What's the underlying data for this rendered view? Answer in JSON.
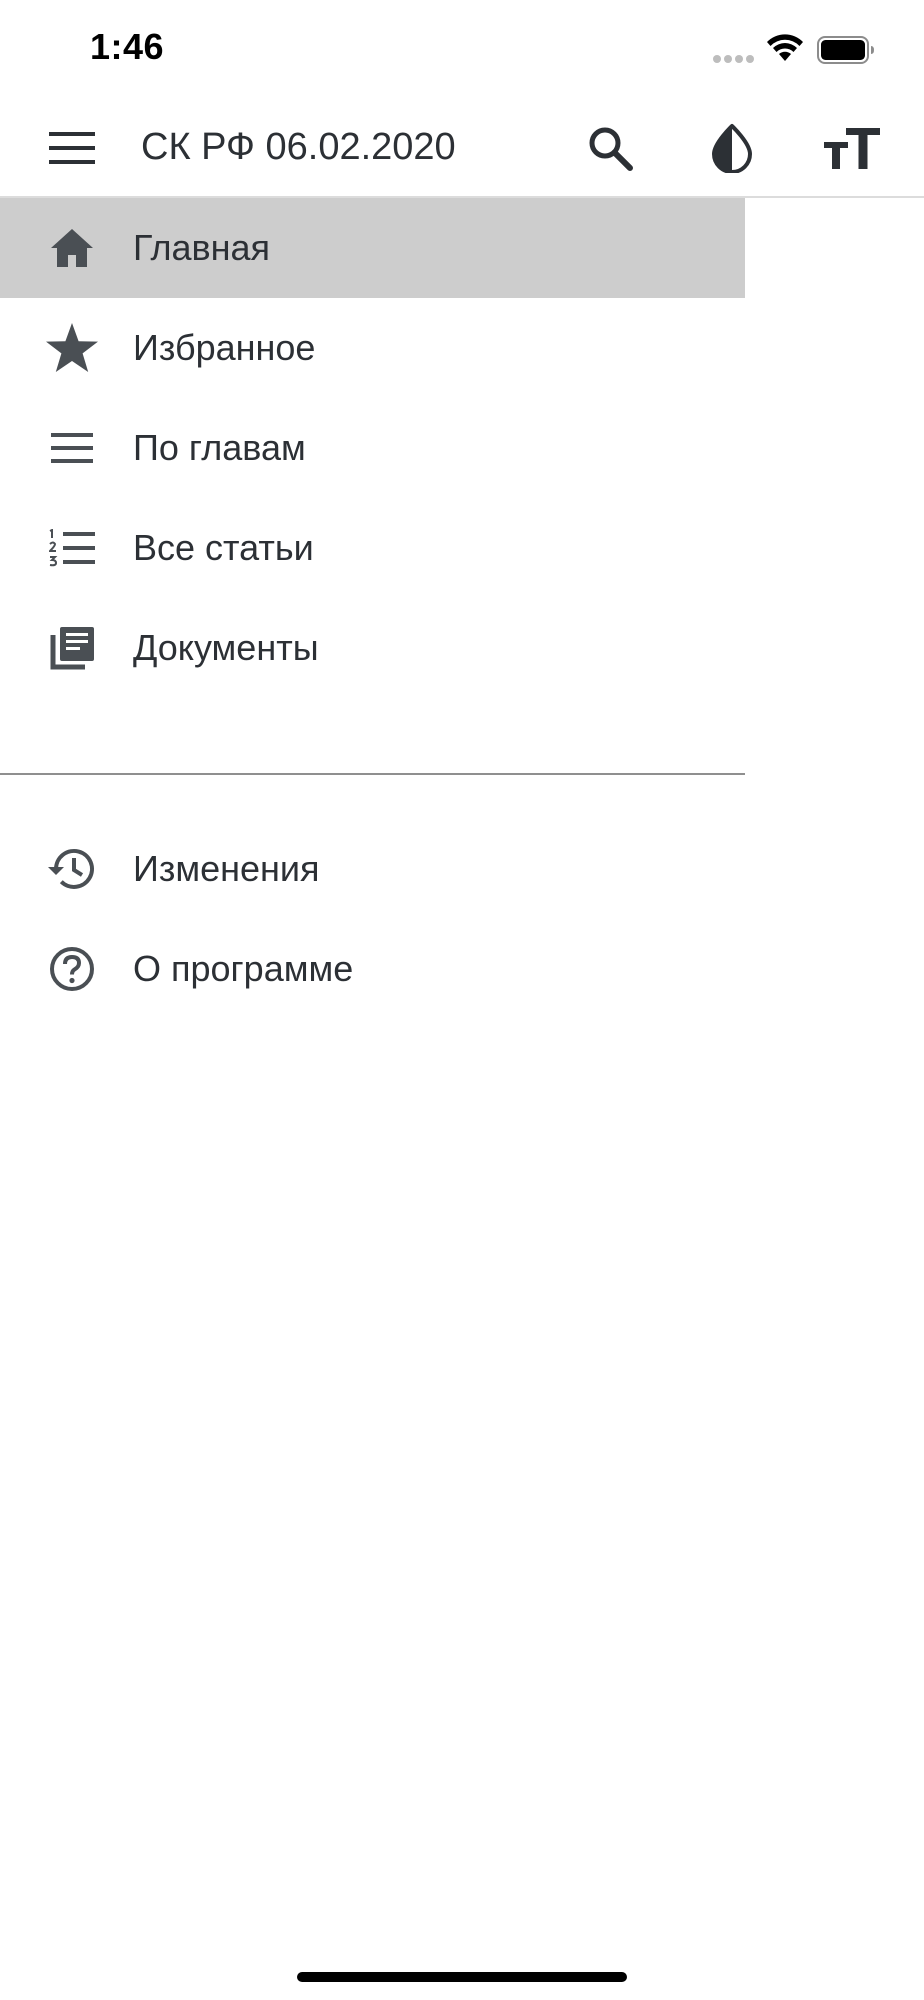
{
  "status_bar": {
    "time": "1:46"
  },
  "app_bar": {
    "title": "СК РФ 06.02.2020",
    "icons": [
      "menu-icon",
      "search-icon",
      "contrast-icon",
      "text-size-icon"
    ]
  },
  "drawer": {
    "items": [
      {
        "label": "Главная",
        "icon": "home-icon",
        "active": true
      },
      {
        "label": "Избранное",
        "icon": "star-icon",
        "active": false
      },
      {
        "label": "По главам",
        "icon": "list-icon",
        "active": false
      },
      {
        "label": "Все статьи",
        "icon": "numbered-list-icon",
        "active": false
      },
      {
        "label": "Документы",
        "icon": "documents-icon",
        "active": false
      }
    ],
    "secondary_items": [
      {
        "label": "Изменения",
        "icon": "history-icon"
      },
      {
        "label": "О программе",
        "icon": "help-icon"
      }
    ]
  },
  "colors": {
    "icon": "#4a4f54",
    "text": "#2c3035",
    "active_background": "#cdcdcd",
    "divider": "#8f8f8f"
  }
}
